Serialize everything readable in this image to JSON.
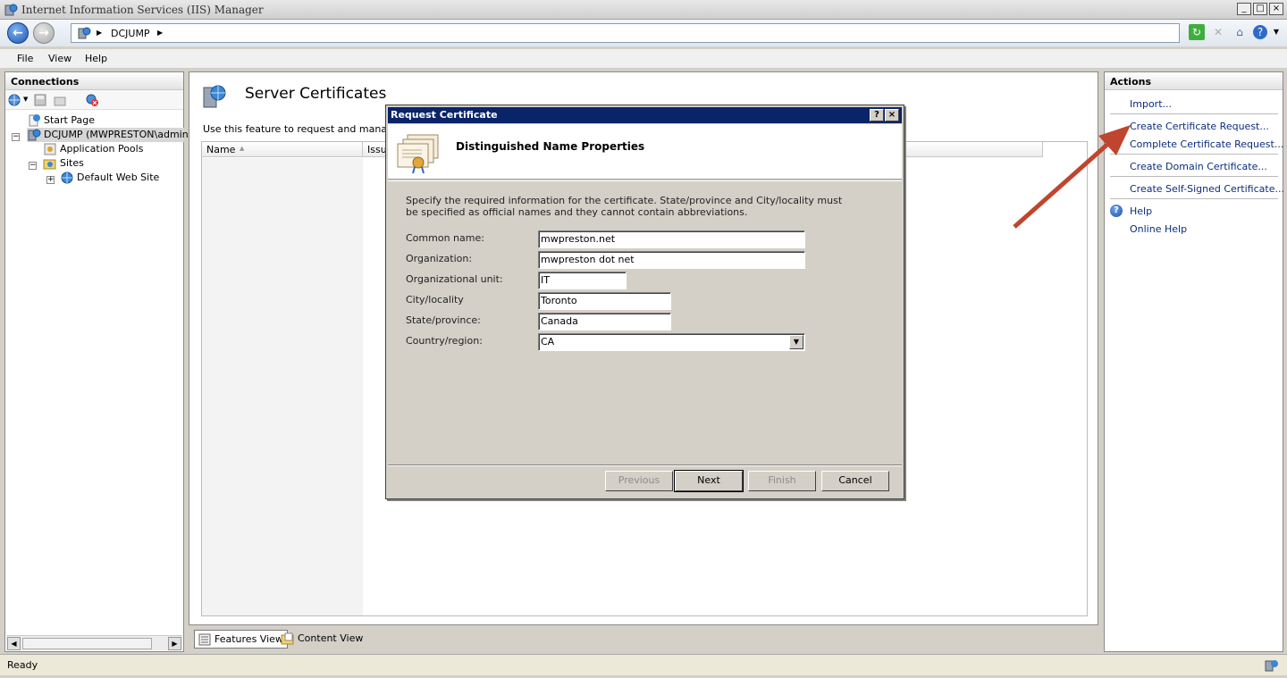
{
  "window": {
    "title": "Internet Information Services (IIS) Manager",
    "buttons": {
      "minimize": "_",
      "maximize": "□",
      "close": "×"
    }
  },
  "address": {
    "crumb": "DCJUMP"
  },
  "menu": {
    "file": "File",
    "view": "View",
    "help": "Help"
  },
  "connections": {
    "header": "Connections",
    "tree": {
      "start_page": "Start Page",
      "server": "DCJUMP (MWPRESTON\\administr",
      "app_pools": "Application Pools",
      "sites": "Sites",
      "default_site": "Default Web Site"
    }
  },
  "center": {
    "title": "Server Certificates",
    "description": "Use this feature to request and manage ce",
    "columns": {
      "name": "Name",
      "issued": "Issu"
    },
    "tabs": {
      "features": "Features View",
      "content": "Content View"
    }
  },
  "actions": {
    "header": "Actions",
    "items": {
      "import": "Import...",
      "create_request": "Create Certificate Request...",
      "complete_request": "Complete Certificate Request...",
      "create_domain": "Create Domain Certificate...",
      "create_self_signed": "Create Self-Signed Certificate...",
      "help": "Help",
      "online_help": "Online Help"
    }
  },
  "status": {
    "text": "Ready"
  },
  "dialog": {
    "title": "Request Certificate",
    "help_btn": "?",
    "close_btn": "×",
    "header": "Distinguished Name Properties",
    "description": "Specify the required information for the certificate. State/province and City/locality must be specified as official names and they cannot contain abbreviations.",
    "fields": {
      "common_name": {
        "label": "Common name:",
        "value": "mwpreston.net"
      },
      "organization": {
        "label": "Organization:",
        "value": "mwpreston dot net"
      },
      "org_unit": {
        "label": "Organizational unit:",
        "value": "IT"
      },
      "city": {
        "label": "City/locality",
        "value": "Toronto"
      },
      "state": {
        "label": "State/province:",
        "value": "Canada"
      },
      "country": {
        "label": "Country/region:",
        "value": "CA"
      }
    },
    "buttons": {
      "previous": "Previous",
      "next": "Next",
      "finish": "Finish",
      "cancel": "Cancel"
    }
  },
  "colors": {
    "dialog_title": "#0a246a",
    "action_link": "#0b2c7d",
    "annotation_arrow": "#c0452e"
  },
  "icons": {
    "back": "back-arrow-icon",
    "forward": "forward-arrow-icon",
    "server": "server-globe-icon",
    "certificate": "certificate-icon",
    "help": "help-icon"
  }
}
